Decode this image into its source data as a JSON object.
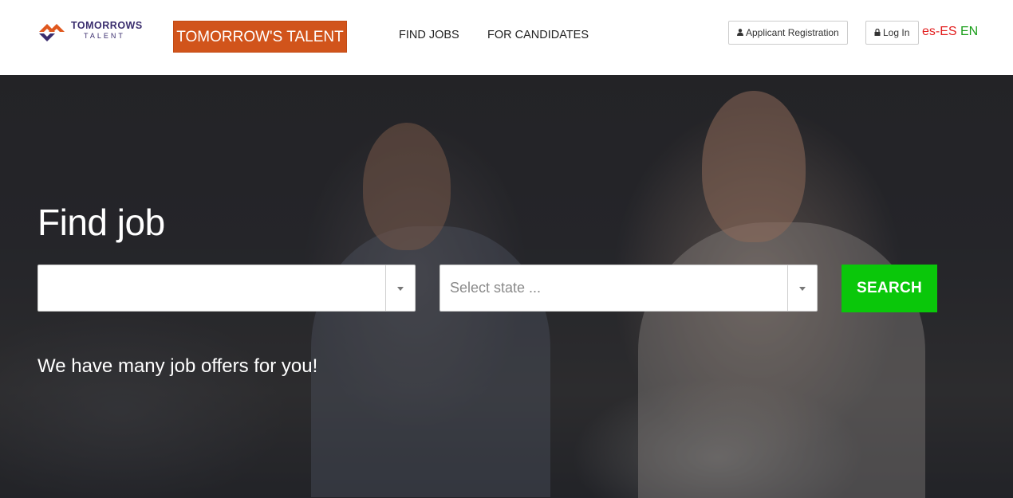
{
  "header": {
    "logo": {
      "text_top": "TOMORROWS",
      "text_bottom": "TALENT",
      "icon": "tomorrows-talent-logo-icon"
    },
    "brand_button": "TOMORROW'S TALENT",
    "nav": [
      {
        "label": "FIND JOBS"
      },
      {
        "label": "FOR CANDIDATES"
      }
    ],
    "register_label": "Applicant Registration",
    "register_icon": "user-icon",
    "login_label": "Log In",
    "login_icon": "lock-icon",
    "lang_es": "es-ES",
    "lang_en": "EN"
  },
  "hero": {
    "title": "Find job",
    "keyword_select": {
      "value": "",
      "placeholder": ""
    },
    "state_select": {
      "value": "",
      "placeholder": "Select state ..."
    },
    "search_label": "SEARCH",
    "subtitle": "We have many job offers for you!"
  },
  "colors": {
    "brand_orange": "#d1541b",
    "search_green": "#0ac70a",
    "lang_es": "#e21d1d",
    "lang_en": "#1a9e1a",
    "logo_navy": "#3a2d6e"
  }
}
